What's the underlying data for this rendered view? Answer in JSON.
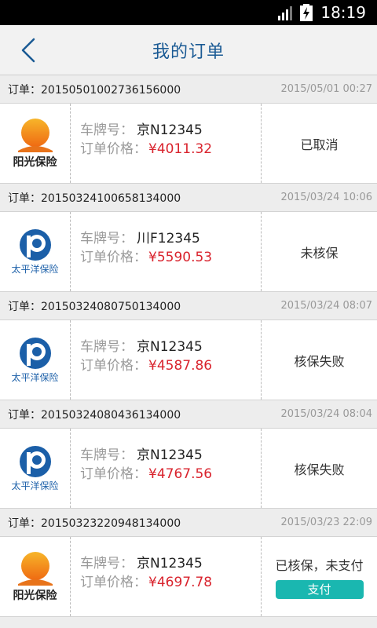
{
  "status_bar": {
    "time": "18:19"
  },
  "header": {
    "title": "我的订单"
  },
  "labels": {
    "order_prefix": "订单：",
    "plate": "车牌号：",
    "price": "订单价格："
  },
  "orders": [
    {
      "id": "20150501002736156000",
      "date": "2015/05/01 00:27",
      "insurer": "阳光保险",
      "logo": "sunshine-logo",
      "plate": "京N12345",
      "price": "¥4011.32",
      "status": "已取消"
    },
    {
      "id": "20150324100658134000",
      "date": "2015/03/24 10:06",
      "insurer": "太平洋保险",
      "logo": "cpic-logo",
      "plate": "川F12345",
      "price": "¥5590.53",
      "status": "未核保"
    },
    {
      "id": "20150324080750134000",
      "date": "2015/03/24 08:07",
      "insurer": "太平洋保险",
      "logo": "cpic-logo",
      "plate": "京N12345",
      "price": "¥4587.86",
      "status": "核保失败"
    },
    {
      "id": "20150324080436134000",
      "date": "2015/03/24 08:04",
      "insurer": "太平洋保险",
      "logo": "cpic-logo",
      "plate": "京N12345",
      "price": "¥4767.56",
      "status": "核保失败"
    },
    {
      "id": "20150323220948134000",
      "date": "2015/03/23 22:09",
      "insurer": "阳光保险",
      "logo": "sunshine-logo",
      "plate": "京N12345",
      "price": "¥4697.78",
      "status": "已核保，未支付",
      "action": "支付"
    }
  ],
  "colors": {
    "title": "#1a5a94",
    "price": "#d9232d",
    "pay_button": "#1ab7b0"
  }
}
